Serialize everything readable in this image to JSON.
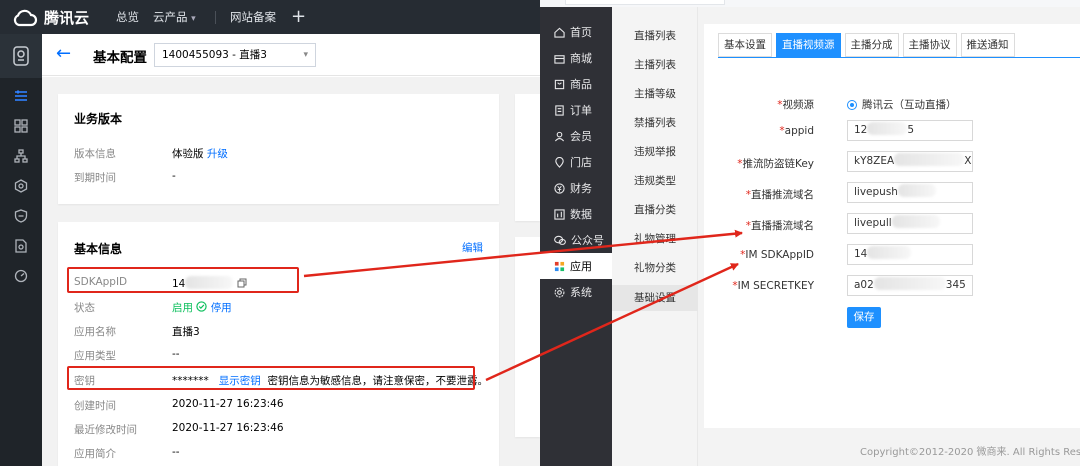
{
  "tc": {
    "brand": "腾讯云",
    "nav": [
      "总览",
      "云产品",
      "网站备案"
    ],
    "nav_caret": "▾",
    "plus": "+",
    "back": "←",
    "page_title": "基本配置",
    "app_select": "1400455093 - 直播3",
    "select_caret": "▾",
    "business": {
      "title": "业务版本",
      "version_label": "版本信息",
      "version_value": "体验版",
      "upgrade": "升级",
      "expire_label": "到期时间",
      "expire_value": "-"
    },
    "basic": {
      "title": "基本信息",
      "edit": "编辑",
      "sdkappid_label": "SDKAppID",
      "sdkappid_prefix": "14",
      "status_label": "状态",
      "status_value": "启用",
      "disable": "停用",
      "appname_label": "应用名称",
      "appname_value": "直播3",
      "apptype_label": "应用类型",
      "apptype_value": "--",
      "secret_label": "密钥",
      "secret_mask": "*******",
      "show_secret": "显示密钥",
      "secret_note": "密钥信息为敏感信息，请注意保密，不要泄露。",
      "created_label": "创建时间",
      "created_value": "2020-11-27 16:23:46",
      "modified_label": "最近修改时间",
      "modified_value": "2020-11-27 16:23:46",
      "intro_label": "应用简介",
      "intro_value": "--"
    }
  },
  "admin": {
    "menu": [
      "首页",
      "商城",
      "商品",
      "订单",
      "会员",
      "门店",
      "财务",
      "数据",
      "公众号",
      "应用",
      "系统"
    ],
    "submenu": [
      "直播列表",
      "主播列表",
      "主播等级",
      "禁播列表",
      "违规举报",
      "违规类型",
      "直播分类",
      "礼物管理",
      "礼物分类",
      "基础设置"
    ],
    "tabs": [
      "基本设置",
      "直播视频源",
      "主播分成",
      "主播协议",
      "推送通知"
    ],
    "form": {
      "source_label": "视频源",
      "source_option": "腾讯云（互动直播）",
      "appid_label": "appid",
      "appid_prefix": "12",
      "appid_suffix": "5",
      "key_label": "推流防盗链Key",
      "key_prefix": "kY8ZEA",
      "key_suffix": "X",
      "push_label": "直播推流域名",
      "push_value": "livepush",
      "pull_label": "直播播流域名",
      "pull_value": "livepull",
      "im_appid_label": "IM SDKAppID",
      "im_appid_prefix": "14",
      "im_secret_label": "IM SECRETKEY",
      "im_secret_prefix": "a02",
      "im_secret_suffix": "345",
      "required_mark": "*",
      "save": "保存"
    },
    "copyright": "Copyright©2012-2020 微商来. All Rights Reserved."
  },
  "colors": {
    "accent_blue": "#1e90ff",
    "tencent_blue": "#006eff",
    "highlight_red": "#e0261b",
    "status_green": "#0abf5b"
  }
}
